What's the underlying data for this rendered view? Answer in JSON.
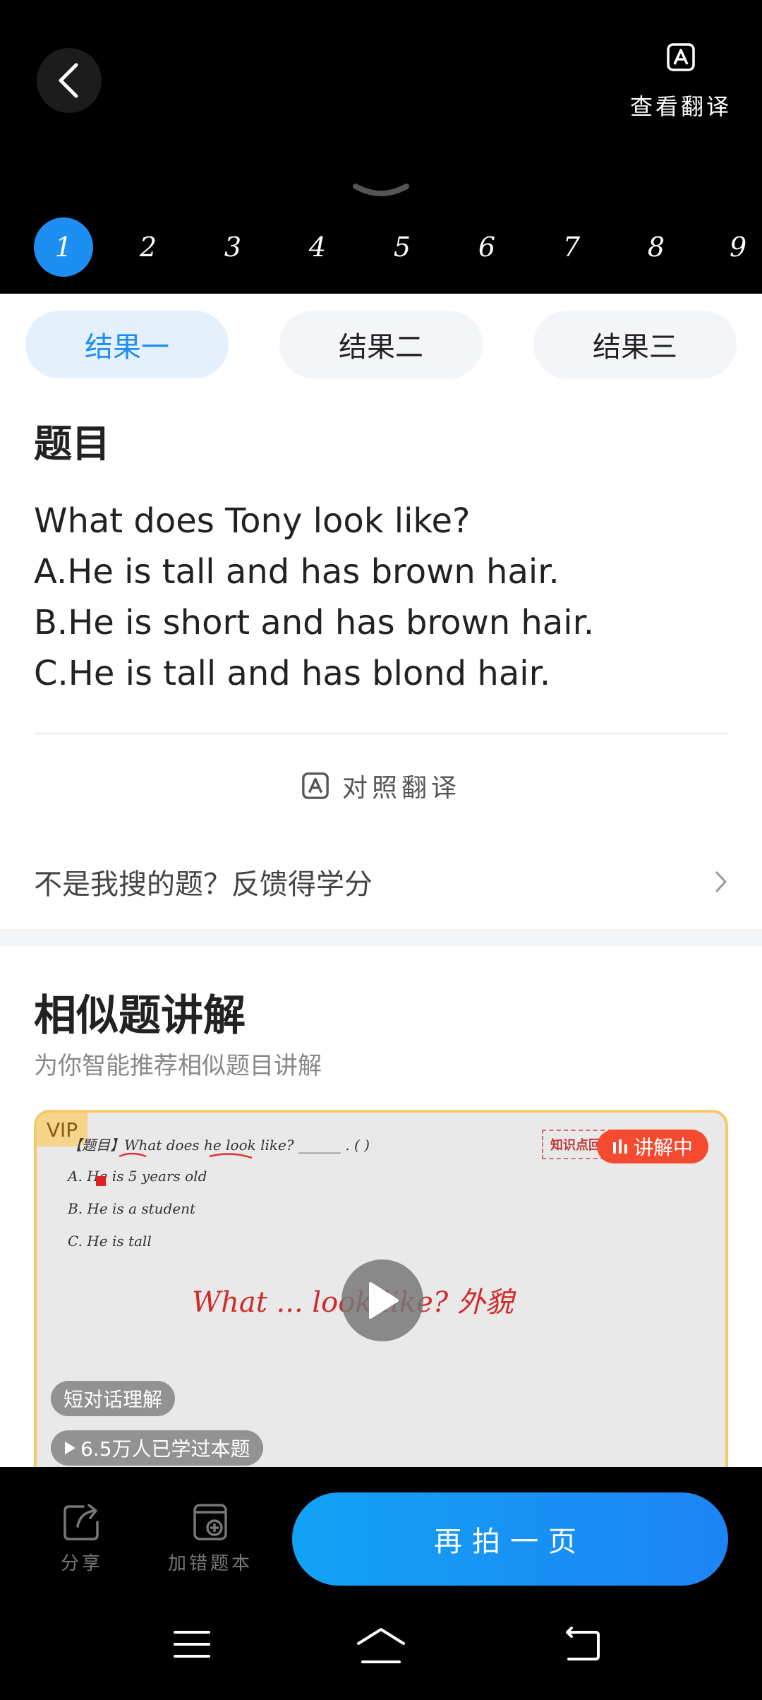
{
  "header": {
    "translate_label": "查看翻译",
    "page_tabs": [
      "1",
      "2",
      "3",
      "4",
      "5",
      "6",
      "7",
      "8",
      "9"
    ],
    "active_page": "1"
  },
  "result_tabs": [
    {
      "label": "结果一",
      "active": true
    },
    {
      "label": "结果二",
      "active": false
    },
    {
      "label": "结果三",
      "active": false
    }
  ],
  "question": {
    "heading": "题目",
    "lines": [
      "What does Tony look like?",
      "A.He is tall and has brown hair.",
      "B.He is short and has brown hair.",
      "C.He is tall and has blond hair."
    ]
  },
  "contrast_translate_label": "对照翻译",
  "feedback_label": "不是我搜的题？反馈得学分",
  "similar": {
    "title": "相似题讲解",
    "subtitle": "为你智能推荐相似题目讲解",
    "video": {
      "vip_label": "VIP",
      "live_label": "讲解中",
      "knowledge_label": "知识点回顾",
      "board_lines": [
        "【题目】What does he look like? ______ . (      )",
        "A. He is 5 years old",
        "B. He is a student",
        "C. He is tall"
      ],
      "handwriting": "What ... look like?  外貌",
      "tag_topic": "短对话理解",
      "tag_learned": "6.5万人已学过本题"
    }
  },
  "bottom_bar": {
    "share_label": "分享",
    "add_wrong_label": "加错题本",
    "retake_label": "再拍一页"
  },
  "colors": {
    "accent": "#1e8ff2",
    "live_red": "#f44a2f",
    "vip_gold": "#f6d48a"
  }
}
